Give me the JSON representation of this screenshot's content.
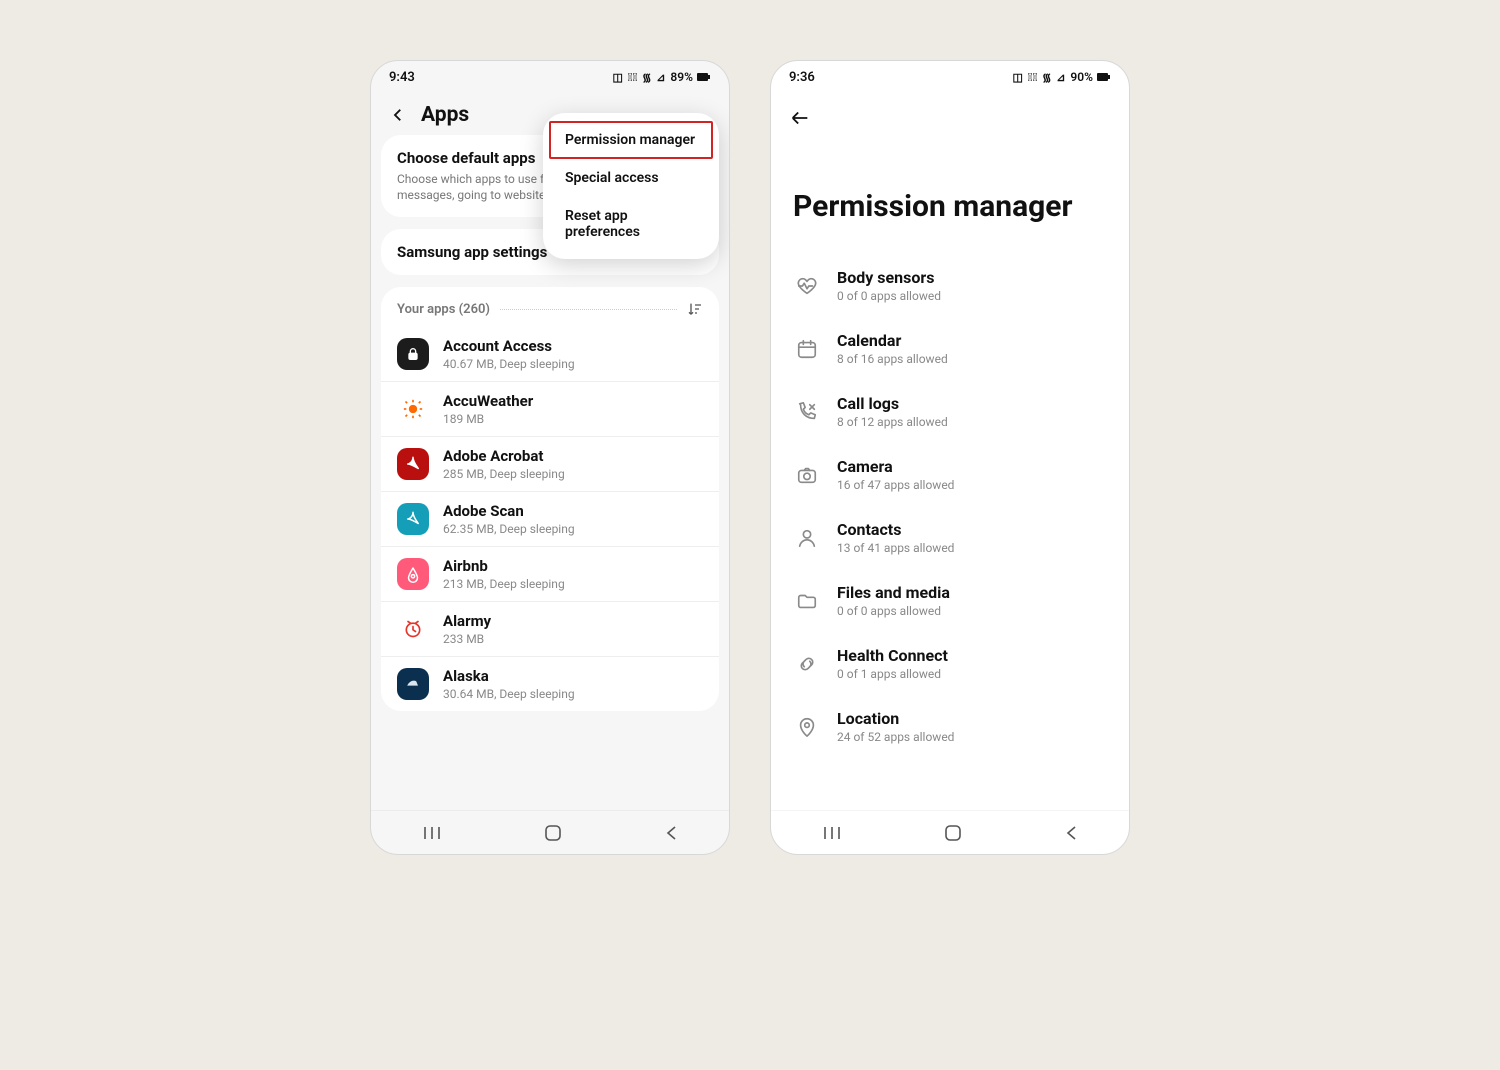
{
  "left": {
    "status": {
      "time": "9:43",
      "battery_text": "89%"
    },
    "header_title": "Apps",
    "popup": {
      "permission_manager": "Permission manager",
      "special_access": "Special access",
      "reset_prefs": "Reset app preferences"
    },
    "card_default": {
      "title": "Choose default apps",
      "sub": "Choose which apps to use for making calls, sending messages, going to websites, and more."
    },
    "card_samsung_title": "Samsung app settings",
    "list_label": "Your apps (260)",
    "apps": [
      {
        "name": "Account Access",
        "meta": "40.67 MB, Deep sleeping",
        "icon": "lock",
        "bg": "#1c1c1c",
        "fg": "#ffffff"
      },
      {
        "name": "AccuWeather",
        "meta": "189 MB",
        "icon": "sun",
        "bg": "#ffffff",
        "fg": "#ff6a00"
      },
      {
        "name": "Adobe Acrobat",
        "meta": "285 MB, Deep sleeping",
        "icon": "acro",
        "bg": "#b90f0f",
        "fg": "#ffffff"
      },
      {
        "name": "Adobe Scan",
        "meta": "62.35 MB, Deep sleeping",
        "icon": "scan",
        "bg": "#159eb8",
        "fg": "#ffffff"
      },
      {
        "name": "Airbnb",
        "meta": "213 MB, Deep sleeping",
        "icon": "airbnb",
        "bg": "#ff5a7a",
        "fg": "#ffffff"
      },
      {
        "name": "Alarmy",
        "meta": "233 MB",
        "icon": "clock",
        "bg": "#ffffff",
        "fg": "#e5362e"
      },
      {
        "name": "Alaska",
        "meta": "30.64 MB, Deep sleeping",
        "icon": "alaska",
        "bg": "#0b2f4f",
        "fg": "#d9e6ef"
      }
    ]
  },
  "right": {
    "status": {
      "time": "9:36",
      "battery_text": "90%"
    },
    "title": "Permission manager",
    "perms": [
      {
        "name": "Body sensors",
        "meta": "0 of 0 apps allowed",
        "icon": "heart"
      },
      {
        "name": "Calendar",
        "meta": "8 of 16 apps allowed",
        "icon": "calendar"
      },
      {
        "name": "Call logs",
        "meta": "8 of 12 apps allowed",
        "icon": "phone"
      },
      {
        "name": "Camera",
        "meta": "16 of 47 apps allowed",
        "icon": "camera"
      },
      {
        "name": "Contacts",
        "meta": "13 of 41 apps allowed",
        "icon": "person"
      },
      {
        "name": "Files and media",
        "meta": "0 of 0 apps allowed",
        "icon": "folder"
      },
      {
        "name": "Health Connect",
        "meta": "0 of 1 apps allowed",
        "icon": "link"
      },
      {
        "name": "Location",
        "meta": "24 of 52 apps allowed",
        "icon": "pin"
      }
    ]
  }
}
